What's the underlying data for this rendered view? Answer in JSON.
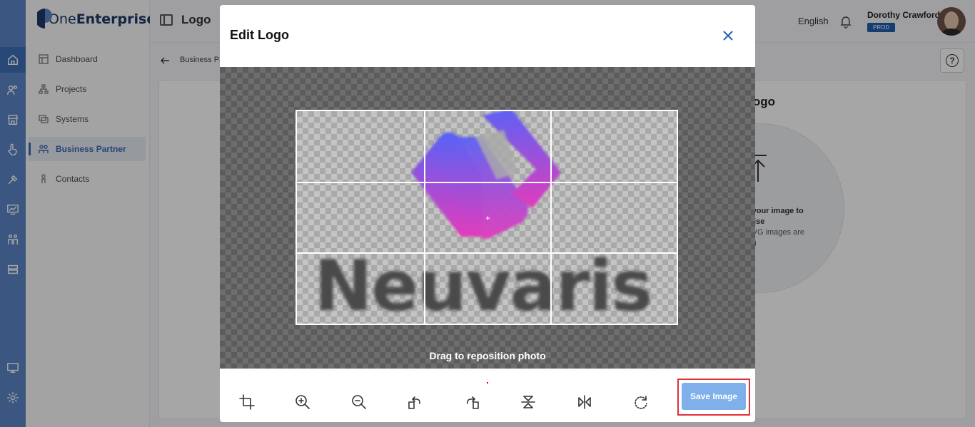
{
  "app": {
    "brand_one": "One",
    "brand_enterprise": "Enterprise",
    "page_title": "Logo",
    "language": "English",
    "user_name": "Dorothy Crawford",
    "env_badge": "PROD"
  },
  "sidebar": {
    "items": [
      {
        "label": "Dashboard",
        "icon": "dashboard-icon"
      },
      {
        "label": "Projects",
        "icon": "projects-icon"
      },
      {
        "label": "Systems",
        "icon": "systems-icon"
      },
      {
        "label": "Business Partner",
        "icon": "business-partner-icon",
        "active": true
      },
      {
        "label": "Contacts",
        "icon": "contacts-icon"
      }
    ]
  },
  "rail_icons": [
    "home-icon",
    "users-icon",
    "store-icon",
    "hand-icon",
    "tools-icon",
    "chart-icon",
    "team-icon",
    "server-icon",
    "monitor-icon",
    "settings-icon"
  ],
  "breadcrumb": "Business Par",
  "background_card": {
    "heading": "l Logo",
    "upload_title": "oad your image to\nterprise",
    "upload_note": "nd SVG images are\norted)"
  },
  "modal": {
    "title": "Edit Logo",
    "drag_hint": "Drag to reposition photo",
    "brand_word": "Neuvaris",
    "save_label": "Save Image",
    "tools": [
      "crop-icon",
      "zoom-in-icon",
      "zoom-out-icon",
      "rotate-left-icon",
      "rotate-right-icon",
      "flip-vertical-icon",
      "flip-horizontal-icon",
      "reset-icon"
    ]
  },
  "colors": {
    "rail": "#5b86c6",
    "accent": "#3b6bb2",
    "save_button": "#7fb0ea",
    "highlight": "#e0303a",
    "mark_gradient": [
      "#5b62f5",
      "#e23cbc"
    ]
  }
}
